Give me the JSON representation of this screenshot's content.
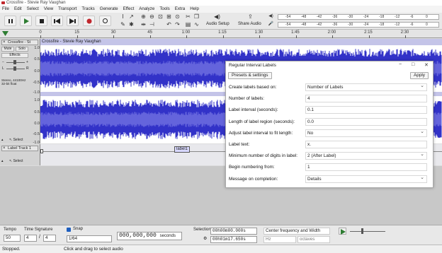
{
  "window": {
    "title": "Crossfire - Stevie Ray Vaughan"
  },
  "menu": [
    "File",
    "Edit",
    "Select",
    "View",
    "Transport",
    "Tracks",
    "Generate",
    "Effect",
    "Analyze",
    "Tools",
    "Extra",
    "Help"
  ],
  "toolbar": {
    "audio_setup": "Audio Setup",
    "share_audio": "Share Audio",
    "meter_ticks": [
      "-54",
      "-48",
      "-42",
      "-36",
      "-30",
      "-24",
      "-18",
      "-12",
      "-6",
      "0"
    ]
  },
  "timeline": {
    "ticks": [
      "0",
      "15",
      "30",
      "45",
      "1:00",
      "1:15",
      "1:30",
      "1:45",
      "2:00",
      "2:15",
      "2:30"
    ]
  },
  "track": {
    "name": "Crossfire - St",
    "clip_title": "Crossfire - Stevie Ray Vaughan",
    "mute": "Mute",
    "solo": "Solo",
    "effects": "Effects",
    "gain_l": "L",
    "gain_r": "R",
    "info": "Stereo, 44100Hz\n32-bit float",
    "select": "Select",
    "scale": [
      "1.0",
      "0.5",
      "0.0",
      "-0.5",
      "-1.0"
    ]
  },
  "label_track": {
    "name": "Label Track 1",
    "select": "Select",
    "label": "label1"
  },
  "dialog": {
    "title": "Regular Interval Labels",
    "presets": "Presets & settings",
    "apply": "Apply",
    "fields": [
      {
        "label": "Create labels based on:",
        "value": "Number of Labels",
        "dropdown": true
      },
      {
        "label": "Number of labels:",
        "value": "4",
        "dropdown": false
      },
      {
        "label": "Label interval (seconds):",
        "value": "0.1",
        "dropdown": false
      },
      {
        "label": "Length of label region (seconds):",
        "value": "0.0",
        "dropdown": false
      },
      {
        "label": "Adjust label interval to fit length:",
        "value": "No",
        "dropdown": true
      },
      {
        "label": "Label text:",
        "value": "x.",
        "dropdown": false
      },
      {
        "label": "Minimum number of digits in label:",
        "value": "2 (After Label)",
        "dropdown": true
      },
      {
        "label": "Begin numbering from:",
        "value": "1",
        "dropdown": false
      },
      {
        "label": "Message on completion:",
        "value": "Details",
        "dropdown": true
      }
    ]
  },
  "bottom": {
    "tempo_label": "Tempo",
    "tempo_value": "50",
    "timesig_label": "Time Signature",
    "timesig_num": "4",
    "timesig_den": "4",
    "snap_label": "Snap",
    "snap_value": "1/64",
    "time_display": "000,000,000",
    "time_unit": "seconds",
    "selection_label": "Selection",
    "sel_start": "00h00m00.000s",
    "sel_end": "00h01m17.650s",
    "spectral_mode": "Center frequency and Width",
    "hz_unit": "Hz",
    "octaves_unit": "octaves"
  },
  "status": {
    "state": "Stopped.",
    "hint": "Click and drag to select audio"
  },
  "colors": {
    "wave": "#3232c8",
    "wave_light": "#6464dc",
    "accent": "#2e7d32",
    "record": "#c0272d"
  }
}
